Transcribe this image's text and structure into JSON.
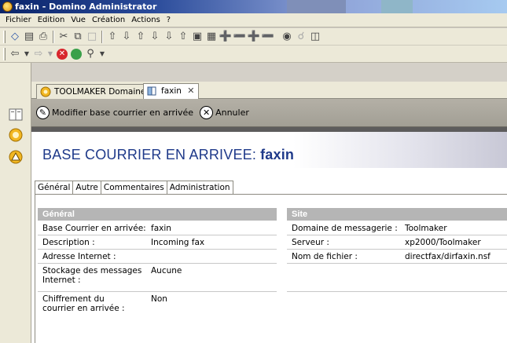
{
  "window": {
    "title": "faxin - Domino Administrator"
  },
  "menu": [
    "Fichier",
    "Edition",
    "Vue",
    "Création",
    "Actions",
    "?"
  ],
  "tabs": [
    {
      "label": "TOOLMAKER Domaine",
      "active": false
    },
    {
      "label": "faxin",
      "active": true,
      "close": "✕"
    }
  ],
  "actions": {
    "edit_label": "Modifier base courrier en arrivée",
    "cancel_label": "Annuler"
  },
  "document": {
    "title_prefix": "BASE COURRIER EN ARRIVEE:",
    "title_name": "faxin"
  },
  "form_tabs": [
    "Général",
    "Autre",
    "Commentaires",
    "Administration"
  ],
  "general": {
    "header": "Général",
    "rows": [
      {
        "label": "Base Courrier en arrivée:",
        "value": "faxin"
      },
      {
        "label": "Description :",
        "value": "Incoming fax"
      },
      {
        "label": "Adresse Internet :",
        "value": ""
      },
      {
        "label": "Stockage des messages Internet :",
        "value": "Aucune"
      },
      {
        "label": "Chiffrement du courrier en arrivée :",
        "value": "Non"
      }
    ]
  },
  "site": {
    "header": "Site",
    "rows": [
      {
        "label": "Domaine de messagerie :",
        "value": "Toolmaker"
      },
      {
        "label": "Serveur :",
        "value": "xp2000/Toolmaker"
      },
      {
        "label": "Nom de fichier :",
        "value": "directfax/dirfaxin.nsf"
      }
    ]
  },
  "colors": {
    "title_blue": "#1f3a8a",
    "section_gray": "#b5b5b5",
    "titlebar_dark": "#0a246a"
  }
}
